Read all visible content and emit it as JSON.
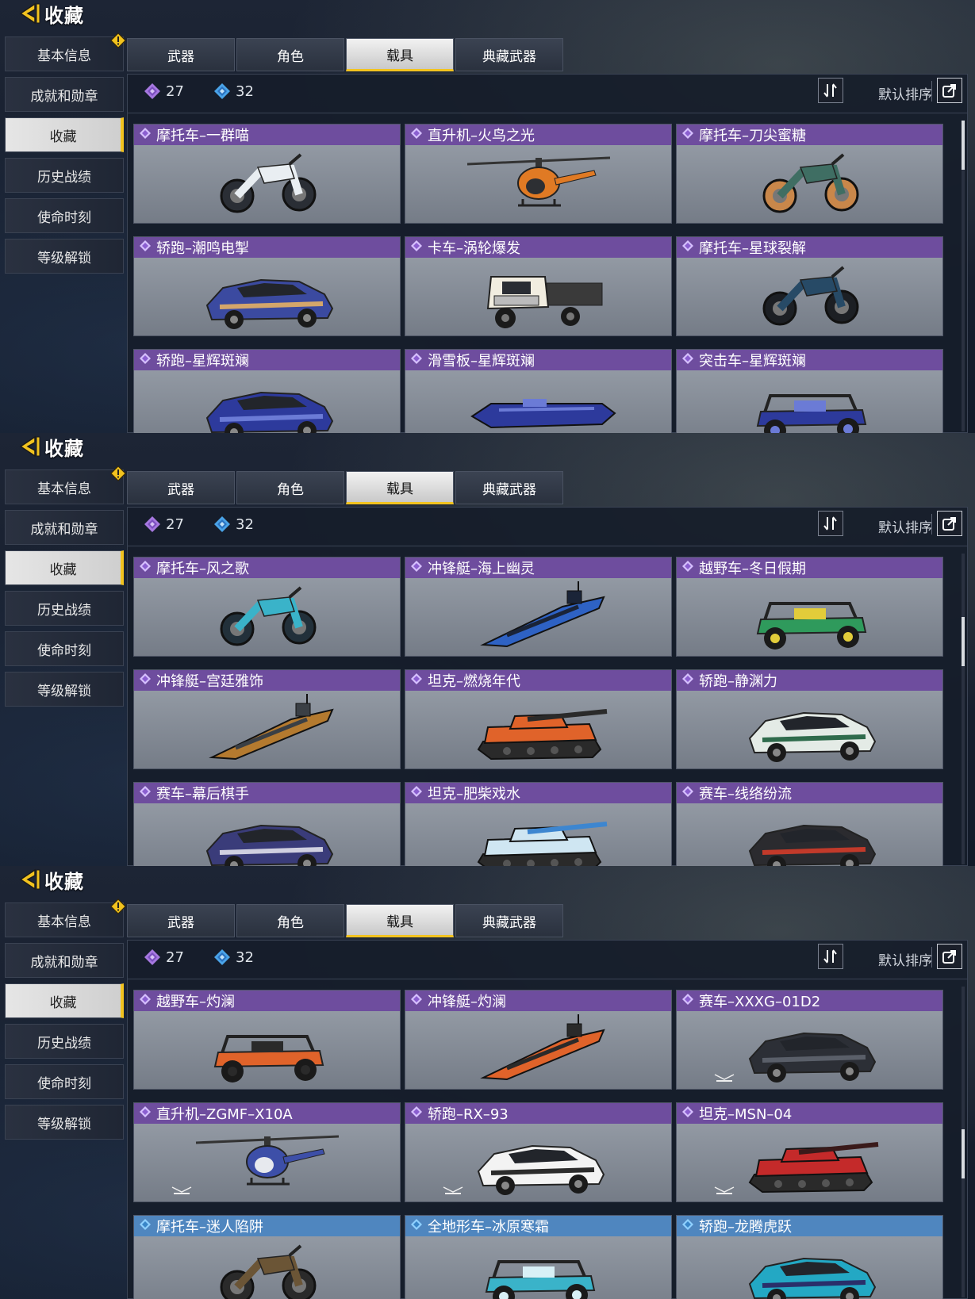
{
  "header": {
    "title": "收藏"
  },
  "sidebar": {
    "items": [
      {
        "label": "基本信息",
        "alert": true
      },
      {
        "label": "成就和勋章"
      },
      {
        "label": "收藏",
        "active": true
      },
      {
        "label": "历史战绩"
      },
      {
        "label": "使命时刻"
      },
      {
        "label": "等级解锁"
      }
    ]
  },
  "tabs": [
    {
      "label": "武器"
    },
    {
      "label": "角色"
    },
    {
      "label": "载具",
      "active": true
    },
    {
      "label": "典藏武器"
    }
  ],
  "stats": {
    "purple_count": "27",
    "blue_count": "32"
  },
  "sort": {
    "label": "默认排序"
  },
  "colors": {
    "accent": "#f2c31f",
    "purple_rarity": "#6e4d9e",
    "blue_rarity": "#4f86bf",
    "purple_gem": "#a678e0",
    "blue_gem": "#4aa3e8"
  },
  "panels": [
    {
      "cards": [
        {
          "name": "摩托车–一群喵",
          "kind": "moto",
          "c1": "#e9eef2",
          "c2": "#2a2e35",
          "rarity": "purple"
        },
        {
          "name": "直升机–火鸟之光",
          "kind": "heli",
          "c1": "#e07a24",
          "c2": "#2d2f33",
          "rarity": "purple"
        },
        {
          "name": "摩托车–刀尖蜜糖",
          "kind": "moto",
          "c1": "#3f6e63",
          "c2": "#c9874a",
          "rarity": "purple"
        },
        {
          "name": "轿跑–潮鸣电掣",
          "kind": "car",
          "c1": "#3b4aa0",
          "c2": "#d4a66a",
          "rarity": "purple"
        },
        {
          "name": "卡车–涡轮爆发",
          "kind": "truck",
          "c1": "#f1ede0",
          "c2": "#3a3a3a",
          "rarity": "purple"
        },
        {
          "name": "摩托车–星球裂解",
          "kind": "moto",
          "c1": "#274a66",
          "c2": "#1c1f24",
          "rarity": "purple"
        },
        {
          "name": "轿跑–星辉斑斓",
          "kind": "car",
          "c1": "#2d3a9c",
          "c2": "#6b7bd6",
          "rarity": "purple"
        },
        {
          "name": "滑雪板–星辉斑斓",
          "kind": "board",
          "c1": "#2d3a9c",
          "c2": "#6b7bd6",
          "rarity": "purple"
        },
        {
          "name": "突击车–星辉斑斓",
          "kind": "buggy",
          "c1": "#2d3a9c",
          "c2": "#6b7bd6",
          "rarity": "purple"
        }
      ],
      "scroll": 0
    },
    {
      "cards": [
        {
          "name": "摩托车–风之歌",
          "kind": "moto",
          "c1": "#3ab3c9",
          "c2": "#22303a",
          "rarity": "purple"
        },
        {
          "name": "冲锋艇–海上幽灵",
          "kind": "boat",
          "c1": "#2e62c4",
          "c2": "#1a2438",
          "rarity": "purple"
        },
        {
          "name": "越野车–冬日假期",
          "kind": "buggy",
          "c1": "#2f9a5c",
          "c2": "#e2cc3a",
          "rarity": "purple"
        },
        {
          "name": "冲锋艇–宫廷雅饰",
          "kind": "boat",
          "c1": "#b47a2f",
          "c2": "#3a3f45",
          "rarity": "purple"
        },
        {
          "name": "坦克–燃烧年代",
          "kind": "tank",
          "c1": "#e0632a",
          "c2": "#2a2a2a",
          "rarity": "purple"
        },
        {
          "name": "轿跑–静渊力",
          "kind": "car",
          "c1": "#e4ebe6",
          "c2": "#2f6b4c",
          "rarity": "purple"
        },
        {
          "name": "赛车–幕后棋手",
          "kind": "car",
          "c1": "#3a3c7a",
          "c2": "#d0d0e0",
          "rarity": "purple"
        },
        {
          "name": "坦克–肥柴戏水",
          "kind": "tank",
          "c1": "#cfe6f2",
          "c2": "#3d86d0",
          "rarity": "purple"
        },
        {
          "name": "赛车–线络纷流",
          "kind": "car",
          "c1": "#2b2b2f",
          "c2": "#c23a2a",
          "rarity": "purple"
        }
      ],
      "scroll": 1
    },
    {
      "cards": [
        {
          "name": "越野车–灼澜",
          "kind": "buggy",
          "c1": "#e0632a",
          "c2": "#2a2a2a",
          "rarity": "purple"
        },
        {
          "name": "冲锋艇–灼澜",
          "kind": "boat",
          "c1": "#e0632a",
          "c2": "#2a2a2a",
          "rarity": "purple"
        },
        {
          "name": "赛车–XXXG–01D2",
          "kind": "car",
          "c1": "#2c2f36",
          "c2": "#5a5f69",
          "rarity": "purple",
          "logo": true
        },
        {
          "name": "直升机–ZGMF–X10A",
          "kind": "heli",
          "c1": "#3d4fa8",
          "c2": "#e7e9ee",
          "rarity": "purple",
          "logo": true
        },
        {
          "name": "轿跑–RX–93",
          "kind": "car",
          "c1": "#f3f3f3",
          "c2": "#2b2b2b",
          "rarity": "purple",
          "logo": true
        },
        {
          "name": "坦克–MSN–04",
          "kind": "tank",
          "c1": "#c42a2a",
          "c2": "#3a1a1a",
          "rarity": "purple",
          "logo": true
        },
        {
          "name": "摩托车–迷人陷阱",
          "kind": "moto",
          "c1": "#6b5536",
          "c2": "#2a2a2a",
          "rarity": "blue"
        },
        {
          "name": "全地形车–冰原寒霜",
          "kind": "buggy",
          "c1": "#3ab3c9",
          "c2": "#d8f0f6",
          "rarity": "blue"
        },
        {
          "name": "轿跑–龙腾虎跃",
          "kind": "car",
          "c1": "#23a8c4",
          "c2": "#2a2f6a",
          "rarity": "blue"
        }
      ],
      "scroll": 2
    }
  ]
}
